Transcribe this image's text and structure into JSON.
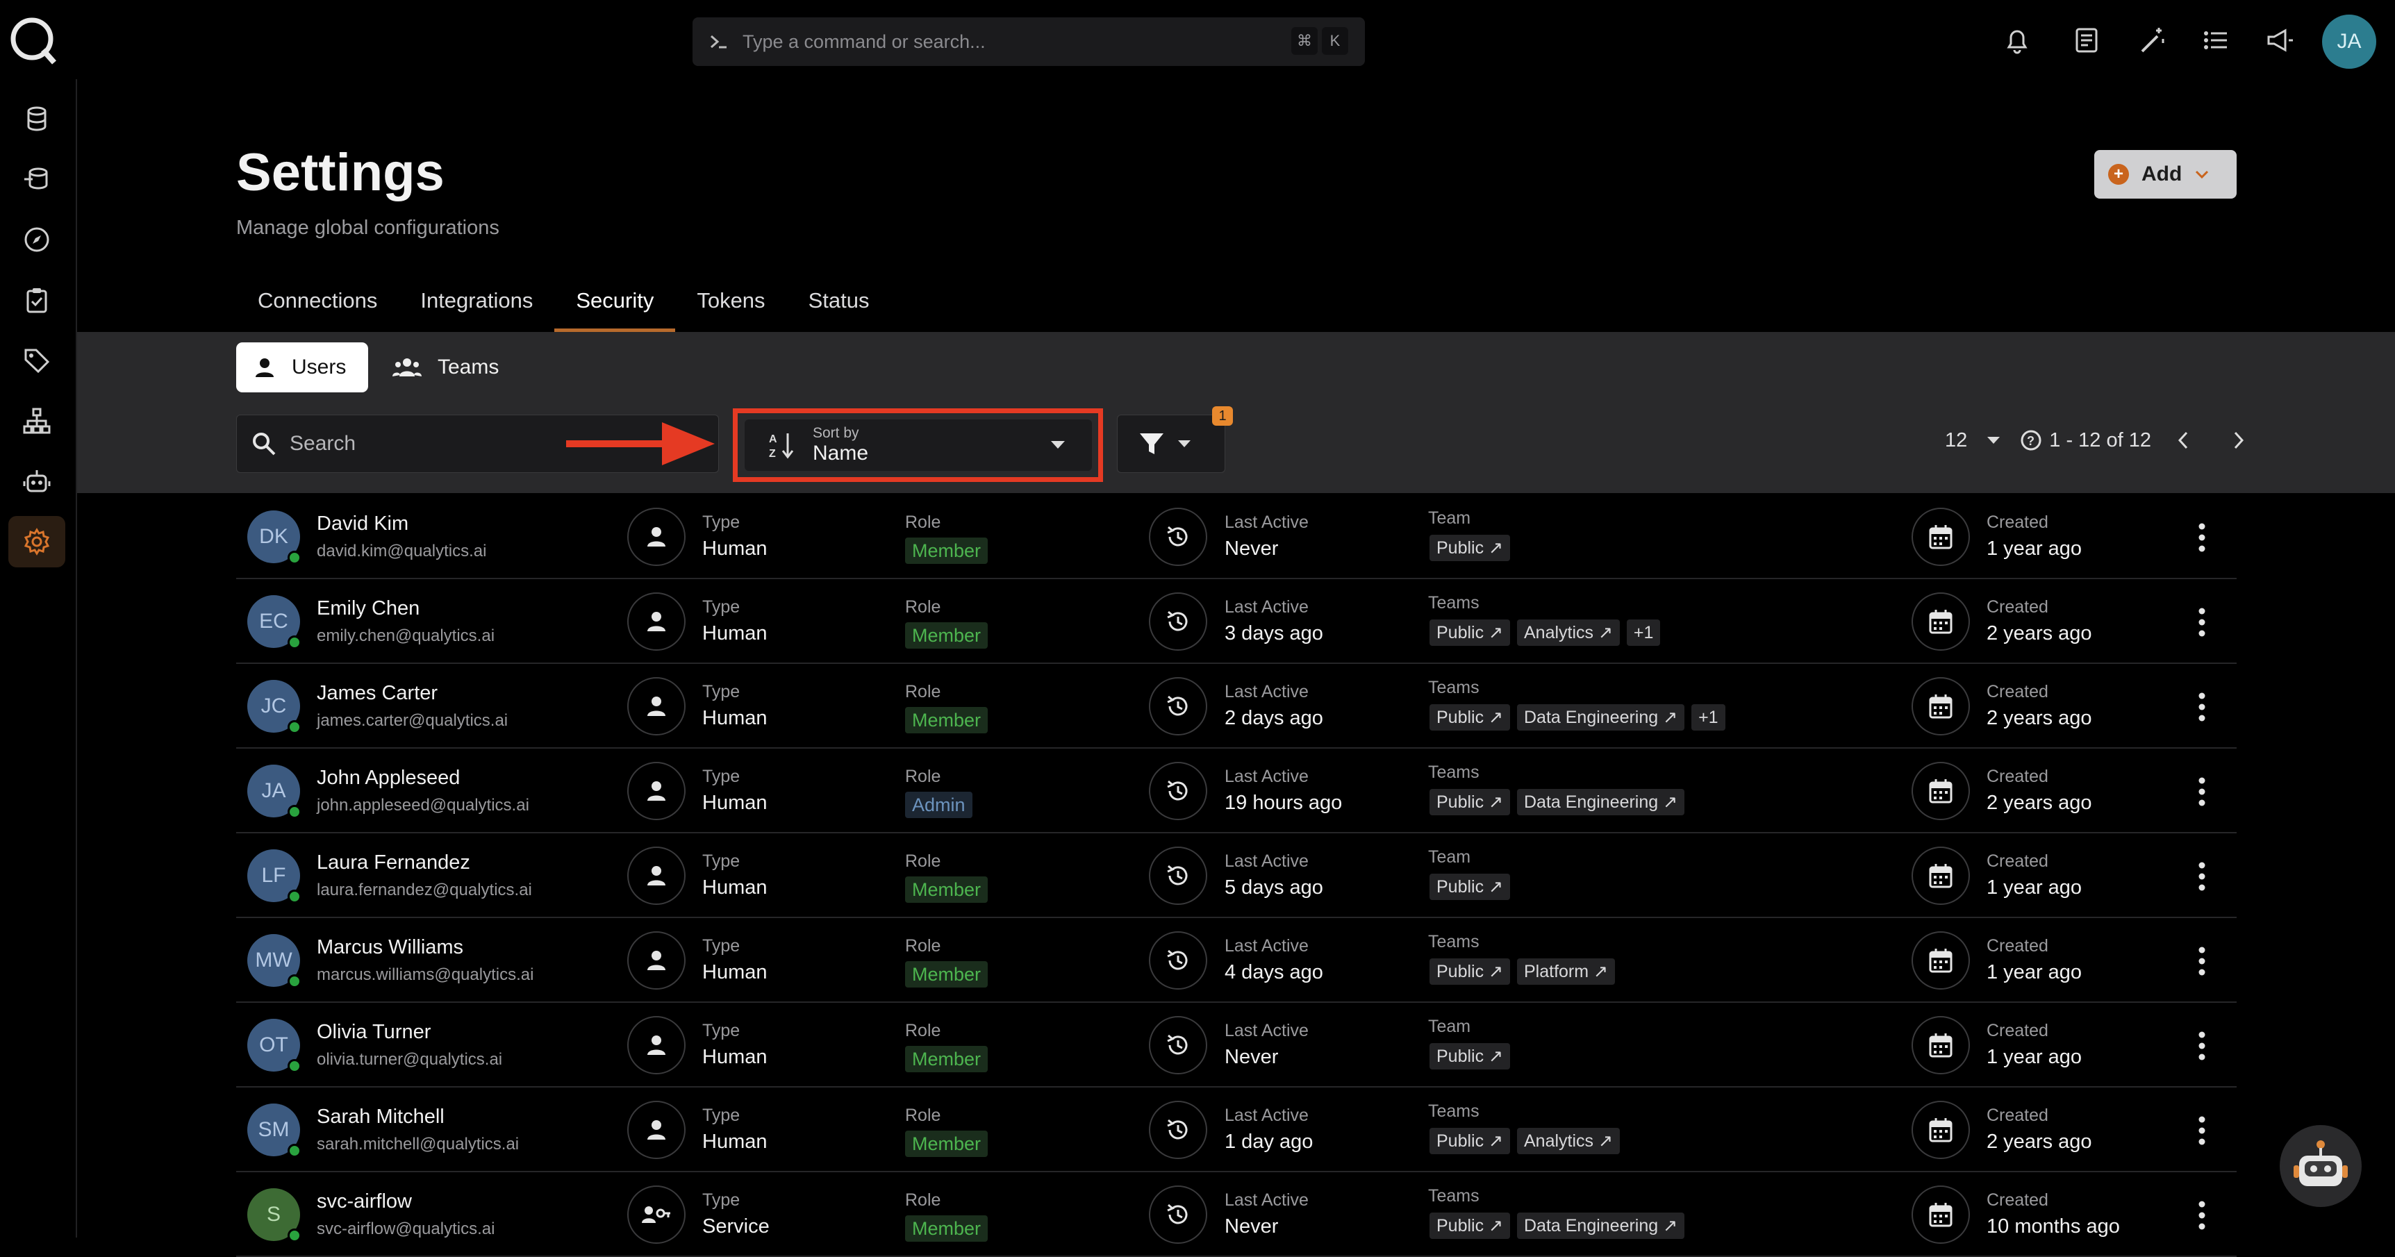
{
  "command_bar": {
    "placeholder": "Type a command or search...",
    "key1": "⌘",
    "key2": "K"
  },
  "user": {
    "initials": "JA"
  },
  "page": {
    "title": "Settings",
    "subtitle": "Manage global configurations",
    "add_label": "Add"
  },
  "tabs": [
    "Connections",
    "Integrations",
    "Security",
    "Tokens",
    "Status"
  ],
  "active_tab": "Security",
  "segments": {
    "users": "Users",
    "teams": "Teams"
  },
  "search": {
    "placeholder": "Search"
  },
  "sort": {
    "label": "Sort by",
    "value": "Name"
  },
  "filter": {
    "count": "1"
  },
  "pagination": {
    "page_size": "12",
    "range": "1 - 12 of 12"
  },
  "columns": {
    "type": "Type",
    "role": "Role",
    "last_active": "Last Active",
    "created": "Created"
  },
  "users": [
    {
      "initials": "DK",
      "name": "David Kim",
      "email": "david.kim@qualytics.ai",
      "type": "Human",
      "role": "Member",
      "last_active": "Never",
      "team_label": "Team",
      "teams": [
        "Public ↗"
      ],
      "created": "1 year ago"
    },
    {
      "initials": "EC",
      "name": "Emily Chen",
      "email": "emily.chen@qualytics.ai",
      "type": "Human",
      "role": "Member",
      "last_active": "3 days ago",
      "team_label": "Teams",
      "teams": [
        "Public ↗",
        "Analytics ↗",
        "+1"
      ],
      "created": "2 years ago"
    },
    {
      "initials": "JC",
      "name": "James Carter",
      "email": "james.carter@qualytics.ai",
      "type": "Human",
      "role": "Member",
      "last_active": "2 days ago",
      "team_label": "Teams",
      "teams": [
        "Public ↗",
        "Data Engineering ↗",
        "+1"
      ],
      "created": "2 years ago"
    },
    {
      "initials": "JA",
      "name": "John Appleseed",
      "email": "john.appleseed@qualytics.ai",
      "type": "Human",
      "role": "Admin",
      "last_active": "19 hours ago",
      "team_label": "Teams",
      "teams": [
        "Public ↗",
        "Data Engineering ↗"
      ],
      "created": "2 years ago"
    },
    {
      "initials": "LF",
      "name": "Laura Fernandez",
      "email": "laura.fernandez@qualytics.ai",
      "type": "Human",
      "role": "Member",
      "last_active": "5 days ago",
      "team_label": "Team",
      "teams": [
        "Public ↗"
      ],
      "created": "1 year ago"
    },
    {
      "initials": "MW",
      "name": "Marcus Williams",
      "email": "marcus.williams@qualytics.ai",
      "type": "Human",
      "role": "Member",
      "last_active": "4 days ago",
      "team_label": "Teams",
      "teams": [
        "Public ↗",
        "Platform ↗"
      ],
      "created": "1 year ago"
    },
    {
      "initials": "OT",
      "name": "Olivia Turner",
      "email": "olivia.turner@qualytics.ai",
      "type": "Human",
      "role": "Member",
      "last_active": "Never",
      "team_label": "Team",
      "teams": [
        "Public ↗"
      ],
      "created": "1 year ago"
    },
    {
      "initials": "SM",
      "name": "Sarah Mitchell",
      "email": "sarah.mitchell@qualytics.ai",
      "type": "Human",
      "role": "Member",
      "last_active": "1 day ago",
      "team_label": "Teams",
      "teams": [
        "Public ↗",
        "Analytics ↗"
      ],
      "created": "2 years ago"
    },
    {
      "initials": "S",
      "name": "svc-airflow",
      "email": "svc-airflow@qualytics.ai",
      "type": "Service",
      "role": "Member",
      "last_active": "Never",
      "team_label": "Teams",
      "teams": [
        "Public ↗",
        "Data Engineering ↗"
      ],
      "created": "10 months ago"
    }
  ],
  "colors": {
    "accent": "#b76a2c",
    "highlight": "#e53a23",
    "member": "#4db54f",
    "admin": "#6c93bd",
    "online": "#29a23e"
  }
}
